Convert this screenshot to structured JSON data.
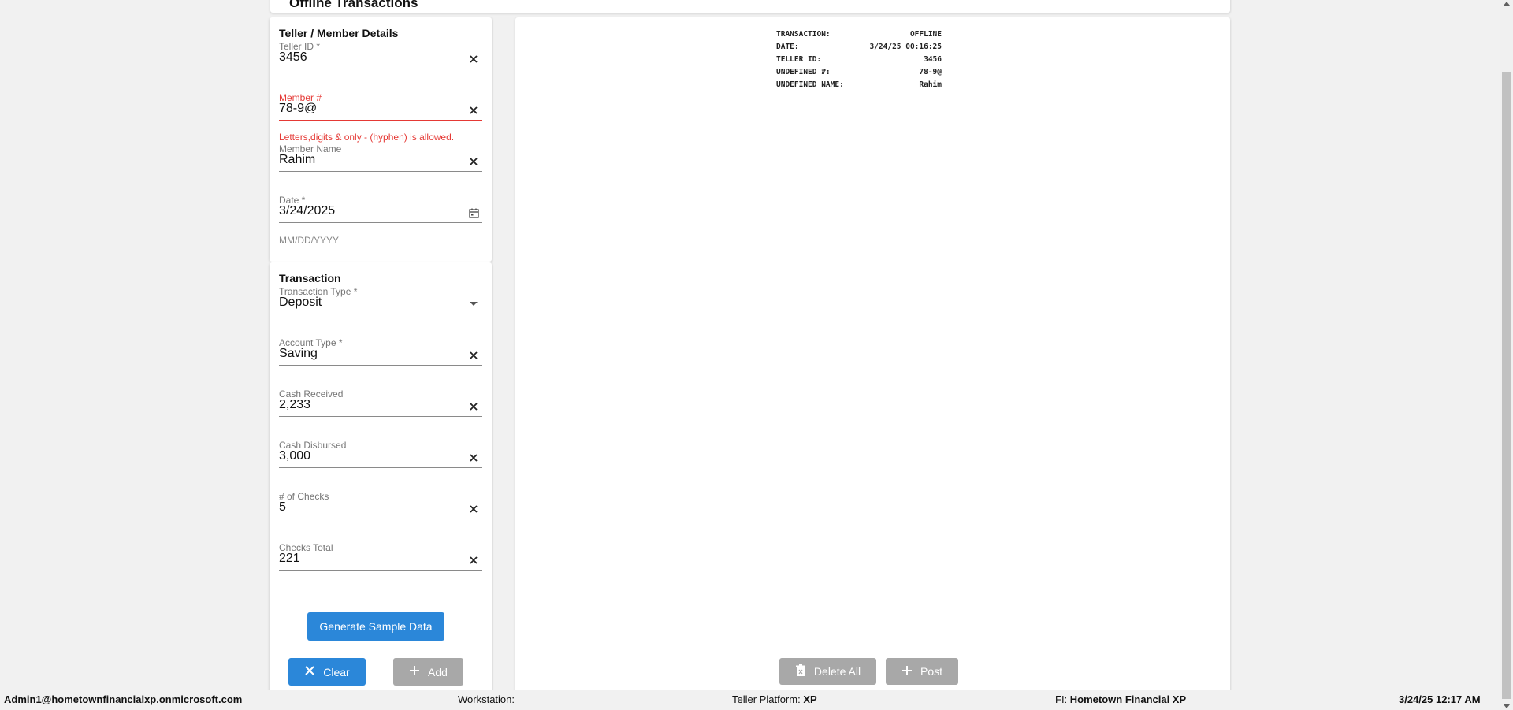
{
  "header": {
    "title": "Offline Transactions"
  },
  "details": {
    "title": "Teller / Member Details",
    "teller_id": {
      "label": "Teller ID *",
      "value": "3456",
      "icon": "close-icon"
    },
    "member_num": {
      "label": "Member #",
      "value": "78-9@",
      "error": "Letters,digits & only - (hyphen) is allowed.",
      "icon": "close-icon"
    },
    "member_name": {
      "label": "Member Name",
      "value": "Rahim",
      "icon": "close-icon"
    },
    "date": {
      "label": "Date *",
      "value": "3/24/2025",
      "hint": "MM/DD/YYYY",
      "icon": "calendar-icon"
    }
  },
  "transaction": {
    "title": "Transaction",
    "type": {
      "label": "Transaction Type *",
      "value": "Deposit",
      "icon": "dropdown-arrow-icon"
    },
    "account": {
      "label": "Account Type *",
      "value": "Saving",
      "icon": "close-icon"
    },
    "cash_received": {
      "label": "Cash Received",
      "value": "2,233",
      "icon": "close-icon"
    },
    "cash_disbursed": {
      "label": "Cash Disbursed",
      "value": "3,000",
      "icon": "close-icon"
    },
    "num_checks": {
      "label": "# of Checks",
      "value": "5",
      "icon": "close-icon"
    },
    "checks_total": {
      "label": "Checks Total",
      "value": "221",
      "icon": "close-icon"
    }
  },
  "buttons": {
    "generate": "Generate Sample Data",
    "clear": "Clear",
    "add": "Add",
    "delete_all": "Delete All",
    "post": "Post"
  },
  "receipt": [
    {
      "key": "TRANSACTION:",
      "value": "OFFLINE"
    },
    {
      "key": "DATE:",
      "value": "3/24/25 00:16:25"
    },
    {
      "key": "TELLER ID:",
      "value": "3456"
    },
    {
      "key": "UNDEFINED #:",
      "value": "78-9@"
    },
    {
      "key": "UNDEFINED NAME:",
      "value": "Rahim"
    }
  ],
  "footer": {
    "user": "Admin1@hometownfinancialxp.onmicrosoft.com",
    "workstation_label": "Workstation:",
    "workstation_value": "",
    "platform_label": "Teller Platform:",
    "platform_value": "XP",
    "fi_label": "FI:",
    "fi_value": "Hometown Financial XP",
    "datetime": "3/24/25 12:17 AM"
  },
  "colors": {
    "accent": "#2b87d9",
    "error": "#e53935",
    "disabled": "#a8a8a8"
  }
}
